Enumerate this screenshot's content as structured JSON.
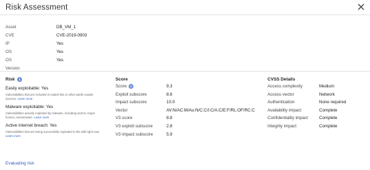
{
  "dialog": {
    "title": "Risk Assessment",
    "close_icon": "close-icon"
  },
  "asset_info": [
    {
      "key": "Asset",
      "value": "DB_VM_1"
    },
    {
      "key": "CVE",
      "value": "CVE-2019-0903"
    },
    {
      "key": "IP",
      "value": "Yes"
    },
    {
      "key": "OS",
      "value": "Yes"
    },
    {
      "key": "OS Version",
      "value": "Yes"
    }
  ],
  "risk": {
    "heading": "Risk",
    "info_icon": "info-icon",
    "items": [
      {
        "label": "Easily exploitable: ",
        "value": "Yes",
        "description": "Vulnerabilities that are included in exploit kits or other public exploit sources.",
        "link": "Learn more"
      },
      {
        "label": "Malware exploitable: ",
        "value": "Yes",
        "description": "Vulnerabilities actively exploited by malware, including worms, trojan horses, ransomware.",
        "link": "Learn more"
      },
      {
        "label": "Active internet breach: ",
        "value": "Yes",
        "description": "Vulnerabilities that are being successfully exploited to the wild right now.",
        "link": "Learn more"
      }
    ]
  },
  "score": {
    "heading": "Score",
    "rows": [
      {
        "key": "Score",
        "value": "9.3",
        "has_icon": true
      },
      {
        "key": "Exploit subscore",
        "value": "8.6"
      },
      {
        "key": "Impact subscore",
        "value": "10.0"
      },
      {
        "key": "Vector",
        "value": "AV:N/AC:M/Au:N/C:C/I:C/A:C/E:F/RL:OF/RC:C"
      },
      {
        "key": "V3 score",
        "value": "8.8"
      },
      {
        "key": "V3 exploit subscore",
        "value": "2.8"
      },
      {
        "key": "V3 impact subscore",
        "value": "5.9"
      }
    ]
  },
  "cvss": {
    "heading": "CVSS Details",
    "rows": [
      {
        "key": "Access complexity",
        "value": "Medium"
      },
      {
        "key": "Access vector",
        "value": "Network"
      },
      {
        "key": "Authentication",
        "value": "None required"
      },
      {
        "key": "Availability impact",
        "value": "Complete"
      },
      {
        "key": "Confidentiality impact",
        "value": "Complete"
      },
      {
        "key": "Integrity impact",
        "value": "Complete"
      }
    ]
  },
  "footer": {
    "link": "Evaluating risk"
  }
}
